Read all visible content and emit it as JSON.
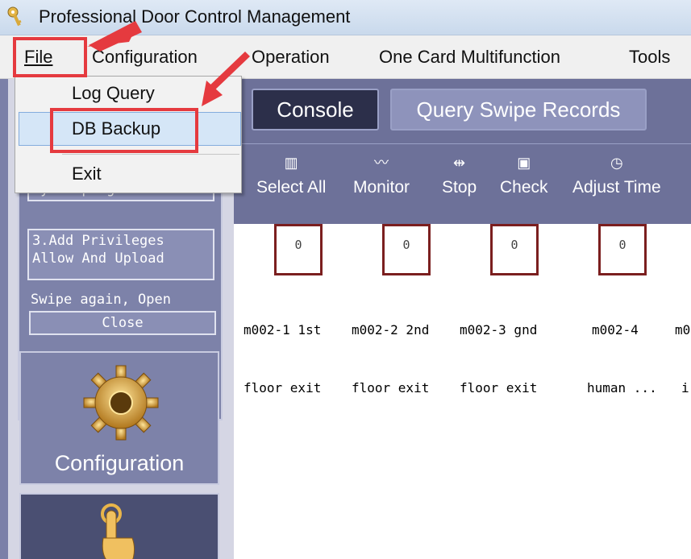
{
  "window": {
    "title": "Professional Door Control Management"
  },
  "menu": {
    "file": "File",
    "configuration": "Configuration",
    "operation": "Operation",
    "one_card": "One Card Multifunction",
    "tools": "Tools"
  },
  "file_menu": {
    "log_query": "Log Query",
    "db_backup": "DB Backup",
    "exit": "Exit"
  },
  "main": {
    "console_button": "Console",
    "query_button": "Query Swipe Records",
    "toolbar": [
      {
        "label": "Select All",
        "icon": "select-all-icon"
      },
      {
        "label": "Monitor",
        "icon": "monitor-icon"
      },
      {
        "label": "Stop",
        "icon": "stop-icon"
      },
      {
        "label": "Check",
        "icon": "check-icon"
      },
      {
        "label": "Adjust Time",
        "icon": "clock-icon"
      }
    ],
    "doors": [
      {
        "count": "0",
        "line1": "m002-1 1st",
        "line2": "floor exit"
      },
      {
        "count": "0",
        "line1": "m002-2 2nd",
        "line2": "floor exit"
      },
      {
        "count": "0",
        "line1": "m002-3 gnd",
        "line2": "floor exit"
      },
      {
        "count": "0",
        "line1": "m002-4",
        "line2": "human ..."
      },
      {
        "line1": "m0",
        "line2": "i"
      }
    ]
  },
  "left_panel": {
    "step2_line2": "By Swiping",
    "step3_line1": "3.Add Privileges",
    "step3_line2": "Allow And Upload",
    "swipe_again": "Swipe again, Open",
    "close_button": "Close",
    "configuration_tile": "Configuration"
  },
  "colors": {
    "highlight": "#e53a3f",
    "panel": "#6d7199",
    "door_border": "#7b1f1f"
  }
}
